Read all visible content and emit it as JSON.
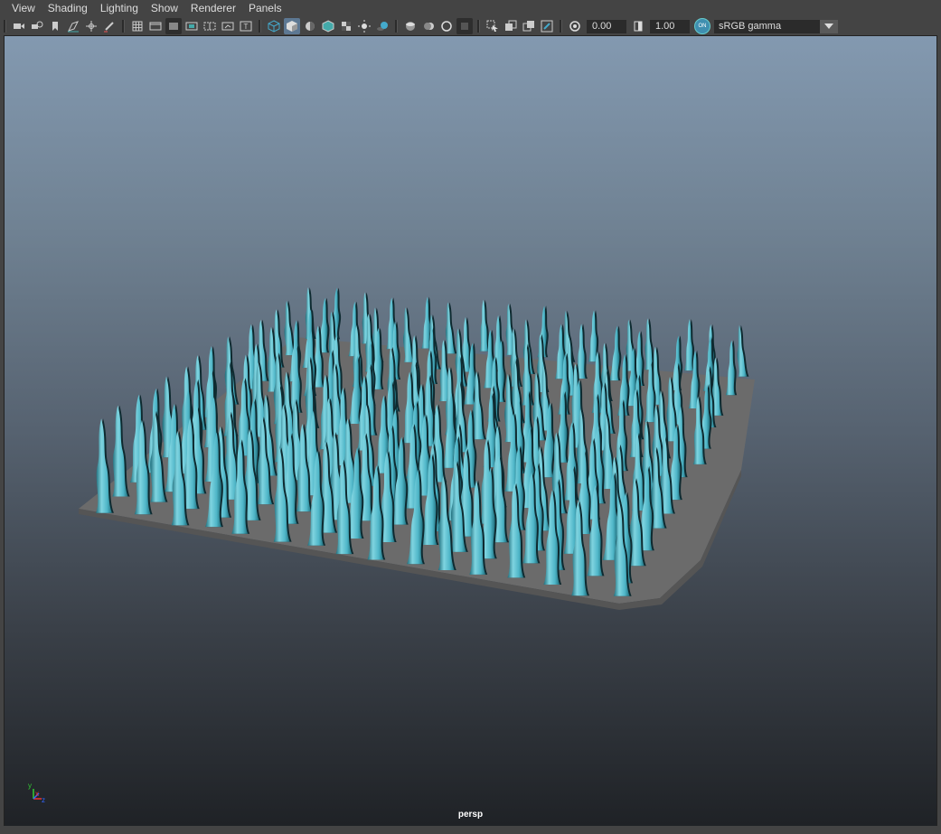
{
  "menubar": {
    "items": [
      {
        "label": "View"
      },
      {
        "label": "Shading"
      },
      {
        "label": "Lighting"
      },
      {
        "label": "Show"
      },
      {
        "label": "Renderer"
      },
      {
        "label": "Panels"
      }
    ]
  },
  "toolbar": {
    "exposure_value": "0.00",
    "gamma_value": "1.00",
    "color_management_badge": "ON",
    "color_space": "sRGB gamma",
    "icons": [
      "camera-icon",
      "camera-attributes-icon",
      "bookmark-icon",
      "image-plane-icon",
      "2d-pan-zoom-icon",
      "grease-pencil-icon",
      "grid-icon",
      "film-gate-icon",
      "resolution-gate-icon",
      "gate-mask-icon",
      "field-chart-icon",
      "safe-action-icon",
      "safe-title-icon",
      "wireframe-icon",
      "smooth-shade-icon",
      "use-default-material-icon",
      "wireframe-on-shaded-icon",
      "textured-icon",
      "use-lights-icon",
      "shadows-icon",
      "screen-space-ao-icon",
      "motion-blur-icon",
      "anti-aliasing-icon",
      "depth-of-field-icon",
      "isolate-select-icon",
      "xray-icon",
      "xray-active-components-icon",
      "xray-joints-icon",
      "exposure-icon",
      "gamma-icon"
    ]
  },
  "viewport": {
    "camera_label": "persp",
    "axis_labels": {
      "x": "x",
      "y": "y",
      "z": "z"
    },
    "colors": {
      "bg_top": "#8399b0",
      "bg_bottom": "#1f2226",
      "plane": "#6b6b6b",
      "fur_light": "#7fd4e0",
      "fur_mid": "#4fb6c8",
      "fur_dark": "#1e6c7a"
    }
  }
}
